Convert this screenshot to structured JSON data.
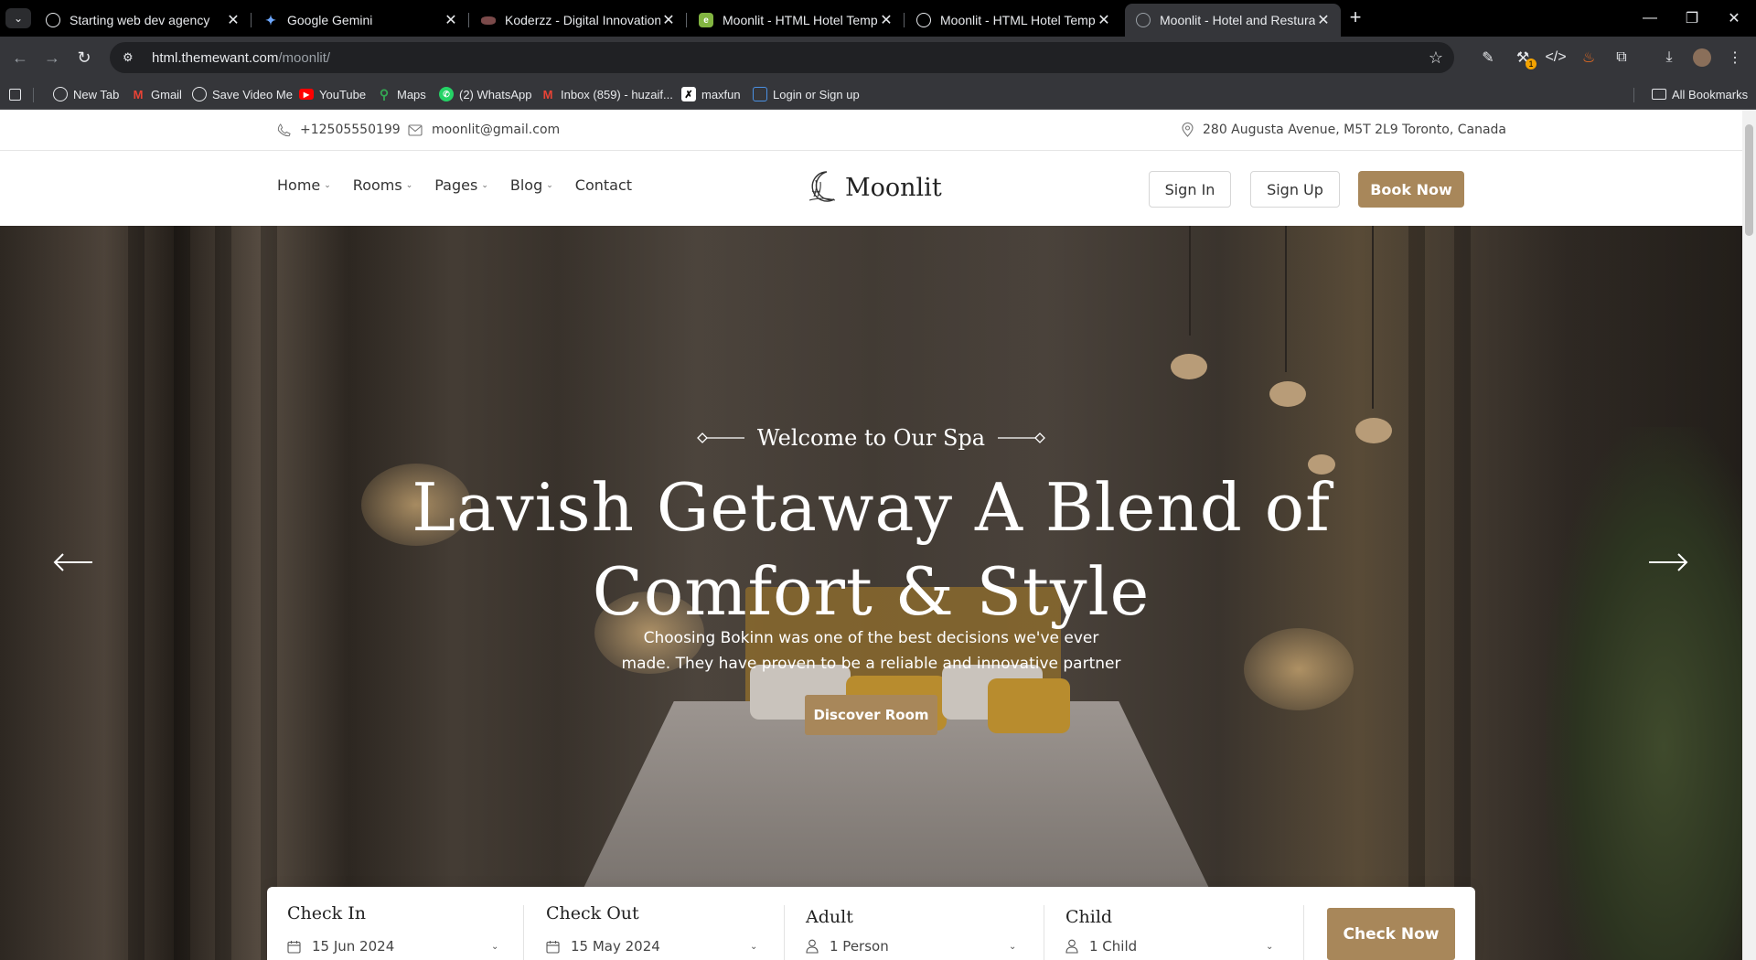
{
  "browser": {
    "tabs": [
      {
        "title": "Starting web dev agency",
        "icon": "openai-icon",
        "active": false
      },
      {
        "title": "Google Gemini",
        "icon": "gemini-icon",
        "active": false
      },
      {
        "title": "Koderzz - Digital Innovation & I",
        "icon": "koderzz-icon",
        "active": false
      },
      {
        "title": "Moonlit - HTML Hotel Template",
        "icon": "envato-icon",
        "active": false
      },
      {
        "title": "Moonlit - HTML Hotel Template",
        "icon": "moonlit-icon",
        "active": false
      },
      {
        "title": "Moonlit - Hotel and Resturant H",
        "icon": "moonlit-icon",
        "active": true
      }
    ],
    "url_host": "html.themewant.com",
    "url_path": "/moonlit/",
    "bookmarks": [
      {
        "label": "New Tab",
        "icon": "chrome-icon"
      },
      {
        "label": "Gmail",
        "icon": "gmail-icon"
      },
      {
        "label": "Save Video Me",
        "icon": "savevideo-icon"
      },
      {
        "label": "YouTube",
        "icon": "youtube-icon"
      },
      {
        "label": "Maps",
        "icon": "maps-icon"
      },
      {
        "label": "(2) WhatsApp",
        "icon": "whatsapp-icon"
      },
      {
        "label": "Inbox (859) - huzaif...",
        "icon": "gmail-icon"
      },
      {
        "label": "maxfun",
        "icon": "maxfun-icon"
      },
      {
        "label": "Login or Sign up",
        "icon": "login-icon"
      }
    ],
    "all_bookmarks_label": "All Bookmarks",
    "extension_badge": "1"
  },
  "topbar": {
    "phone": "+12505550199",
    "email": "moonlit@gmail.com",
    "address": "280 Augusta Avenue, M5T 2L9 Toronto, Canada"
  },
  "nav": {
    "menu": [
      "Home",
      "Rooms",
      "Pages",
      "Blog",
      "Contact"
    ],
    "logo_text": "Moonlit",
    "sign_in": "Sign In",
    "sign_up": "Sign Up",
    "book_now": "Book Now"
  },
  "hero": {
    "subtitle": "Welcome to Our Spa",
    "title_line1": "Lavish Getaway A Blend of",
    "title_line2": "Comfort & Style",
    "text": "Choosing Bokinn was one of the best decisions we've ever made. They have proven to be a reliable and innovative partner",
    "button": "Discover Room"
  },
  "booking": {
    "check_in_label": "Check In",
    "check_in_value": "15 Jun 2024",
    "check_out_label": "Check Out",
    "check_out_value": "15 May 2024",
    "adult_label": "Adult",
    "adult_value": "1 Person",
    "child_label": "Child",
    "child_value": "1 Child",
    "button": "Check Now"
  },
  "colors": {
    "accent": "#a8875a",
    "chrome_dark": "#000000",
    "chrome_toolbar": "#35363a"
  }
}
